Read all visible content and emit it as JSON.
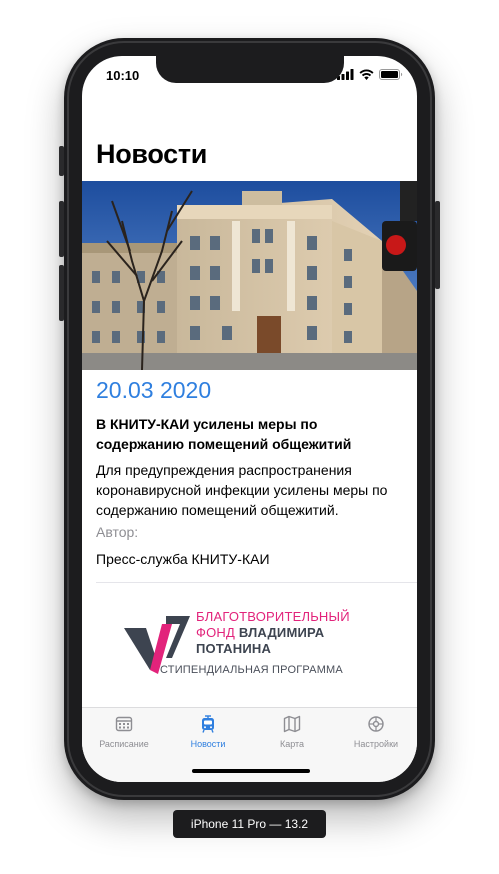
{
  "status_bar": {
    "time": "10:10"
  },
  "page": {
    "title": "Новости"
  },
  "news_item": {
    "date": "20.03 2020",
    "headline": "В КНИТУ-КАИ усилены меры по содержанию помещений общежитий",
    "summary": "Для предупреждения распространения коронавирусной инфекции усилены меры по содержанию помещений общежитий.",
    "author_label": "Автор:",
    "author": "Пресс-служба КНИТУ-КАИ"
  },
  "fund_logo": {
    "line1": "БЛАГОТВОРИТЕЛЬНЫЙ",
    "line2a": "ФОНД",
    "line2b": "ВЛАДИМИРА",
    "line3": "ПОТАНИНА",
    "line4": "СТИПЕНДИАЛЬНАЯ ПРОГРАММА",
    "pink": "#e2237b",
    "dark": "#3d4450"
  },
  "tab_bar": {
    "tabs": [
      {
        "label": "Расписание",
        "icon": "calendar-icon",
        "active": false
      },
      {
        "label": "Новости",
        "icon": "tram-icon",
        "active": true
      },
      {
        "label": "Карта",
        "icon": "map-icon",
        "active": false
      },
      {
        "label": "Настройки",
        "icon": "gear-icon",
        "active": false
      }
    ]
  },
  "device": {
    "label": "iPhone 11 Pro — 13.2"
  },
  "colors": {
    "accent": "#2f7fdf",
    "inactive": "#8e8e93"
  }
}
